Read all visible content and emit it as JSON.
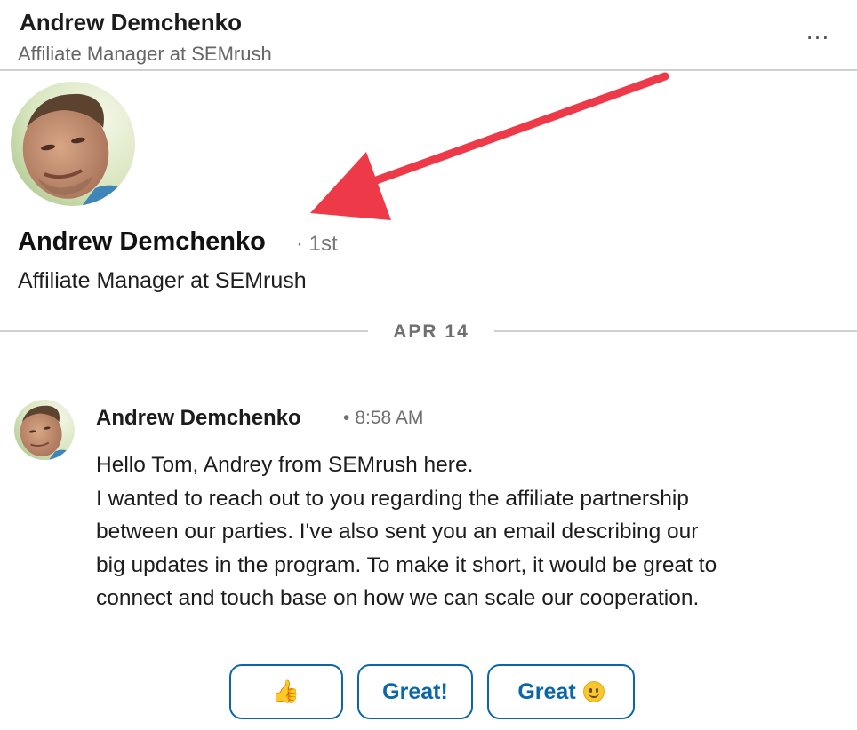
{
  "header": {
    "name": "Andrew Demchenko",
    "title": "Affiliate Manager at SEMrush",
    "more_label": "…"
  },
  "profile": {
    "name": "Andrew Demchenko",
    "degree": "· 1st",
    "headline": "Affiliate Manager at SEMrush"
  },
  "date_divider": "APR 14",
  "message": {
    "sender": "Andrew Demchenko",
    "time": "8:58 AM",
    "lines": [
      "Hello Tom, Andrey from SEMrush here.",
      "I wanted to reach out to you regarding the affiliate partnership",
      "between our parties. I've also sent you an email describing our",
      "big updates in the program. To make it short, it would be great to",
      "connect and touch base on how we can scale our cooperation."
    ]
  },
  "smart_replies": [
    {
      "label": "👍"
    },
    {
      "label": "Great!"
    },
    {
      "label": "Great"
    }
  ],
  "colors": {
    "accent": "#0a66a8",
    "arrow": "#ee3a48"
  },
  "icons": [
    "more-icon",
    "thumbs-up-icon",
    "smiley-icon",
    "red-arrow-annotation"
  ]
}
